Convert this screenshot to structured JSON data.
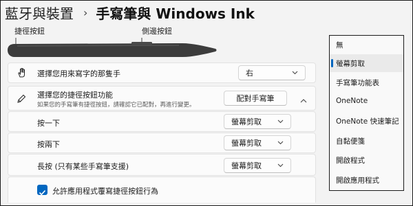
{
  "breadcrumb": {
    "parent": "藍牙與裝置",
    "separator": "›",
    "current": "手寫筆與 Windows Ink"
  },
  "pen_image": {
    "shortcut_label": "捷徑按鈕",
    "side_label": "側邊按鈕"
  },
  "handedness": {
    "label": "選擇您用來寫字的那隻手",
    "value": "右"
  },
  "shortcut_button": {
    "title": "選擇您的捷徑按鈕功能",
    "subtitle": "如果您的手寫筆有捷徑按鈕，請確認它已配對，再進行變更。",
    "pair_button": "配對手寫筆",
    "rows": [
      {
        "label": "按一下",
        "value": "螢幕剪取"
      },
      {
        "label": "按兩下",
        "value": "螢幕剪取"
      },
      {
        "label": "長按 (只有某些手寫筆支援)",
        "value": "螢幕剪取"
      }
    ],
    "allow_override_label": "允許應用程式覆寫捷徑按鈕行為",
    "allow_override_checked": true
  },
  "dropdown_menu": {
    "items": [
      "無",
      "螢幕剪取",
      "手寫筆功能表",
      "OneNote",
      "OneNote 快速筆記",
      "自黏便箋",
      "開啟程式",
      "開啟應用程式"
    ],
    "selected_index": 1
  },
  "colors": {
    "accent": "#0067c0",
    "pen": "#3c3c3c"
  },
  "icons": {
    "hand": "hand-icon",
    "pen": "pen-icon",
    "chevron_down": "chevron-down-icon",
    "chevron_up": "chevron-up-icon",
    "check": "checkmark-icon"
  }
}
